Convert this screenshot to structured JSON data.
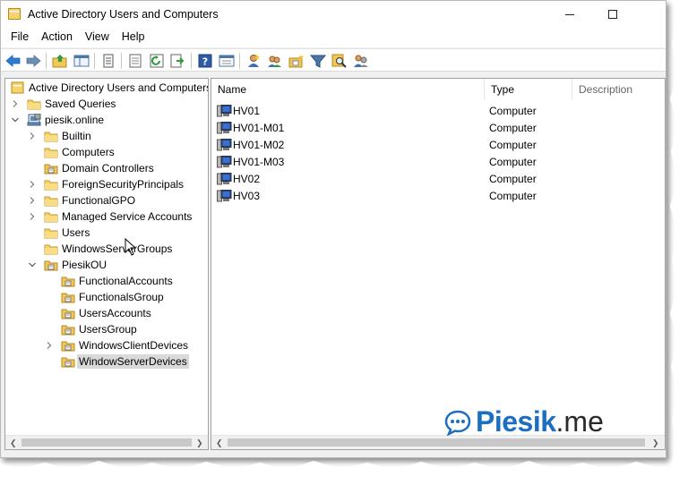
{
  "window": {
    "title": "Active Directory Users and Computers",
    "minimize_icon": "minimize-icon",
    "maximize_icon": "maximize-icon"
  },
  "menu": [
    "File",
    "Action",
    "View",
    "Help"
  ],
  "toolbar": {
    "icons": [
      "back-arrow-icon",
      "forward-arrow-icon",
      "up-folder-icon",
      "show-tree-icon",
      "copy-icon",
      "export-list-icon",
      "refresh-icon",
      "export-icon",
      "help-icon",
      "mmc-view-icon",
      "new-user-icon",
      "new-group-icon",
      "new-ou-icon",
      "filter-icon",
      "find-icon",
      "add-to-group-icon"
    ]
  },
  "tree": {
    "root": "Active Directory Users and Computers",
    "nodes": [
      {
        "label": "Saved Queries",
        "icon": "folder-icon",
        "chevron": "right"
      },
      {
        "label": "piesik.online",
        "icon": "domain-icon",
        "chevron": "down"
      },
      {
        "label": "Builtin",
        "icon": "folder-icon",
        "chevron": "right"
      },
      {
        "label": "Computers",
        "icon": "folder-icon",
        "chevron": ""
      },
      {
        "label": "Domain Controllers",
        "icon": "ou-icon",
        "chevron": ""
      },
      {
        "label": "ForeignSecurityPrincipals",
        "icon": "folder-icon",
        "chevron": "right"
      },
      {
        "label": "FunctionalGPO",
        "icon": "folder-icon",
        "chevron": "right"
      },
      {
        "label": "Managed Service Accounts",
        "icon": "folder-icon",
        "chevron": "right"
      },
      {
        "label": "Users",
        "icon": "folder-icon",
        "chevron": ""
      },
      {
        "label": "WindowsServerGroups",
        "icon": "folder-icon",
        "chevron": ""
      },
      {
        "label": "PiesikOU",
        "icon": "ou-icon",
        "chevron": "down"
      },
      {
        "label": "FunctionalAccounts",
        "icon": "ou-icon",
        "chevron": ""
      },
      {
        "label": "FunctionalsGroup",
        "icon": "ou-icon",
        "chevron": ""
      },
      {
        "label": "UsersAccounts",
        "icon": "ou-icon",
        "chevron": ""
      },
      {
        "label": "UsersGroup",
        "icon": "ou-icon",
        "chevron": ""
      },
      {
        "label": "WindowsClientDevices",
        "icon": "ou-icon",
        "chevron": "right"
      },
      {
        "label": "WindowServerDevices",
        "icon": "ou-icon",
        "chevron": "",
        "selected": true
      }
    ]
  },
  "list": {
    "columns": [
      "Name",
      "Type",
      "Description"
    ],
    "rows": [
      {
        "name": "HV01",
        "type": "Computer",
        "icon": "computer-icon"
      },
      {
        "name": "HV01-M01",
        "type": "Computer",
        "icon": "computer-icon"
      },
      {
        "name": "HV01-M02",
        "type": "Computer",
        "icon": "computer-icon"
      },
      {
        "name": "HV01-M03",
        "type": "Computer",
        "icon": "computer-icon"
      },
      {
        "name": "HV02",
        "type": "Computer",
        "icon": "computer-icon"
      },
      {
        "name": "HV03",
        "type": "Computer",
        "icon": "computer-icon"
      }
    ]
  },
  "watermark": {
    "brand": "Piesik",
    "tld": ".me",
    "icon": "chat-bubble-icon"
  },
  "colors": {
    "accent": "#1b6ec2",
    "selection": "#d9d9d9",
    "folder": "#f1c75b",
    "window_bg": "#f0f0f0"
  }
}
